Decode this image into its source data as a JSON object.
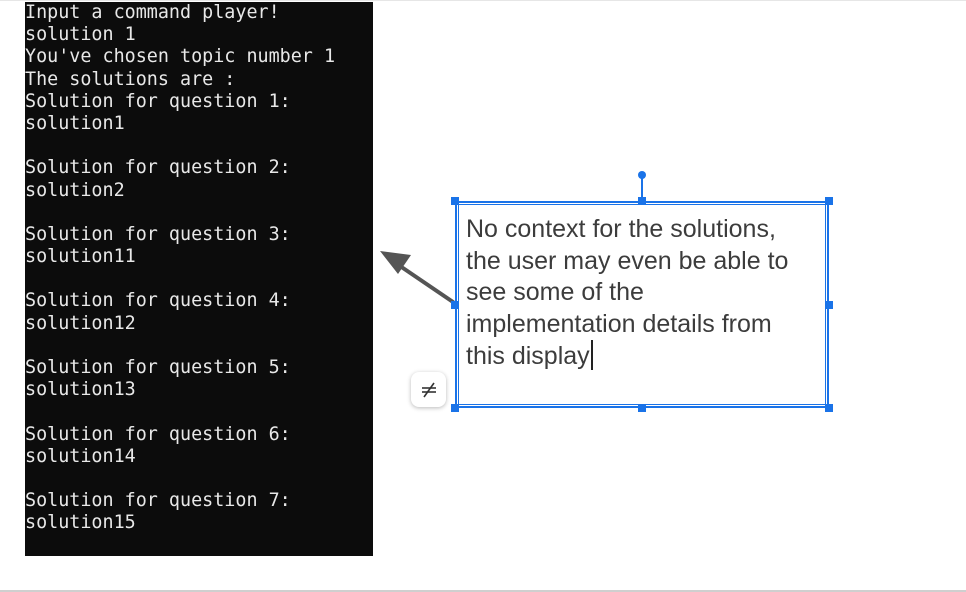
{
  "terminal": {
    "lines": [
      "Input a command player!",
      "solution 1",
      "You've chosen topic number 1",
      "The solutions are :",
      "Solution for question 1:",
      "solution1",
      "",
      "Solution for question 2:",
      "solution2",
      "",
      "Solution for question 3:",
      "solution11",
      "",
      "Solution for question 4:",
      "solution12",
      "",
      "Solution for question 5:",
      "solution13",
      "",
      "Solution for question 6:",
      "solution14",
      "",
      "Solution for question 7:",
      "solution15"
    ]
  },
  "annotation": {
    "text": "No context for the solutions, the user may even be able to see some of the implementation details from this display"
  },
  "anchor_button": {
    "icon": "unlink-anchor-icon"
  },
  "colors": {
    "selection": "#1a73e8",
    "terminal_bg": "#0c0c0c",
    "terminal_fg": "#e8e8e8",
    "arrow": "#555555"
  }
}
